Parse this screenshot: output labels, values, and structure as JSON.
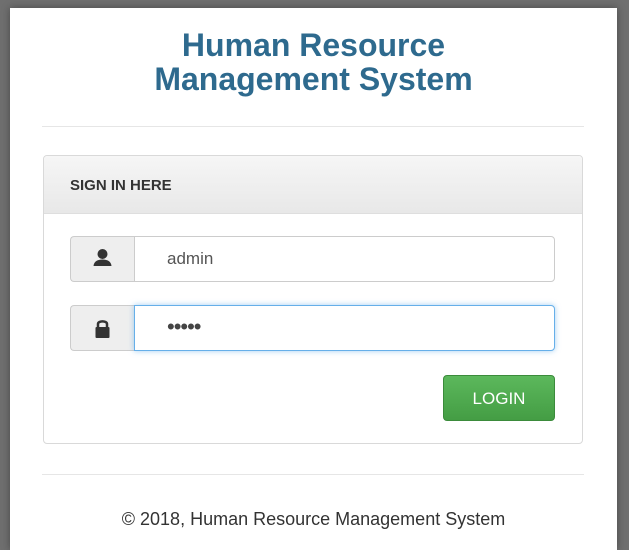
{
  "app": {
    "title_line1": "Human Resource",
    "title_line2": "Management System"
  },
  "login_panel": {
    "heading": "SIGN IN HERE",
    "username": {
      "icon": "user-icon",
      "value": "admin"
    },
    "password": {
      "icon": "lock-icon",
      "masked_value": "•••••"
    },
    "login_button_label": "LOGIN"
  },
  "footer": {
    "text": "© 2018, Human Resource Management System"
  },
  "colors": {
    "title": "#2e6a8e",
    "login_button": "#5cb85c",
    "focus_border": "#66afe9"
  }
}
